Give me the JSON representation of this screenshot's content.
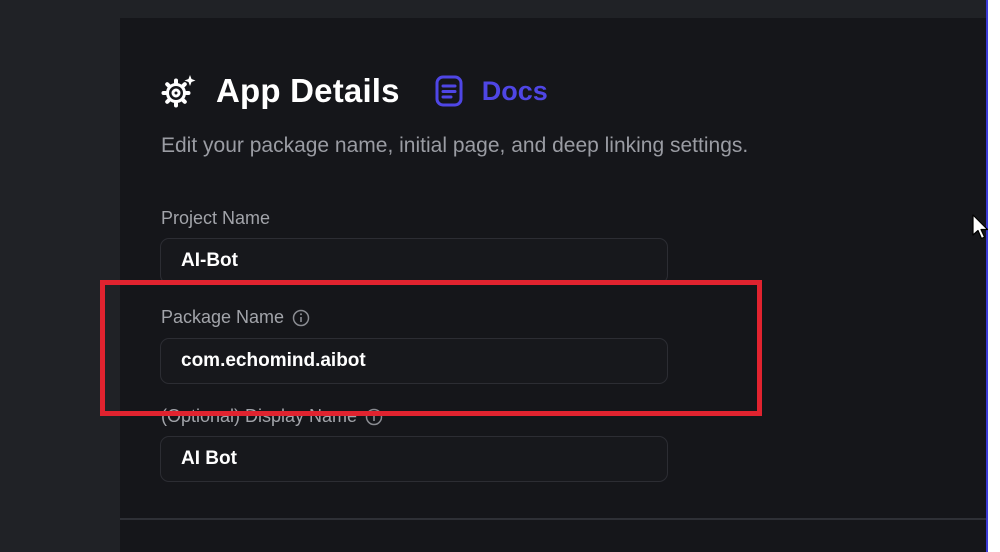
{
  "header": {
    "title": "App Details",
    "docs_label": "Docs",
    "subtitle": "Edit your package name, initial page, and deep linking settings."
  },
  "fields": {
    "project_name": {
      "label": "Project Name",
      "value": "AI-Bot"
    },
    "package_name": {
      "label": "Package Name",
      "value": "com.echomind.aibot"
    },
    "display_name": {
      "label": "(Optional) Display Name",
      "value": "AI Bot"
    }
  },
  "icons": {
    "settings": "gear-icon",
    "docs": "document-icon",
    "info": "info-icon",
    "cursor": "mouse-pointer-icon"
  },
  "colors": {
    "accent": "#4f46e5",
    "highlight": "#e0232f",
    "background": "#15161a"
  }
}
